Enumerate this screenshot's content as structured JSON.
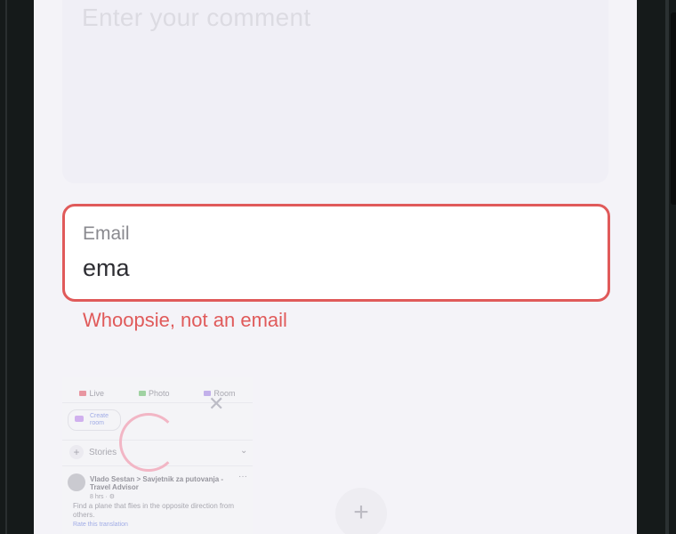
{
  "comment": {
    "placeholder": "Enter your comment",
    "value": ""
  },
  "email": {
    "label": "Email",
    "value": "ema",
    "error": "Whoopsie, not an email"
  },
  "attachment_preview": {
    "tabs": [
      {
        "label": "Live",
        "icon": "video-icon"
      },
      {
        "label": "Photo",
        "icon": "photo-icon"
      },
      {
        "label": "Room",
        "icon": "room-icon"
      }
    ],
    "create_room": "Create room",
    "stories": "Stories",
    "post": {
      "author": "Vlado Sestan > Savjetnik za putovanja - Travel Advisor",
      "meta": "8 hrs · ⚙",
      "text": "Find a plane that flies in the opposite direction from others.",
      "translation_link": "Rate this translation"
    }
  },
  "icons": {
    "remove_attachment": "close-icon",
    "loading": "spinner-icon",
    "add": "plus-icon"
  },
  "colors": {
    "error": "#e05a5a",
    "background": "#f4f3f8",
    "spinner": "#f2b6c5"
  }
}
